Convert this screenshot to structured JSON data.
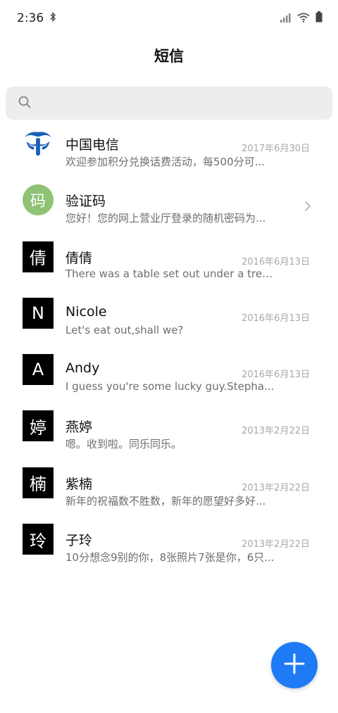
{
  "status_bar": {
    "time": "2:36"
  },
  "header": {
    "title": "短信"
  },
  "search": {
    "placeholder": ""
  },
  "conversations": [
    {
      "avatar_text": "",
      "avatar_type": "china-telecom-logo",
      "name": "中国电信",
      "date": "2017年6月30日",
      "preview": "欢迎参加积分兑换话费活动，每500分可..."
    },
    {
      "avatar_text": "码",
      "avatar_type": "circle",
      "name": "验证码",
      "date": "",
      "preview": "您好！您的网上营业厅登录的随机密码为..."
    },
    {
      "avatar_text": "倩",
      "avatar_type": "square",
      "name": "倩倩",
      "date": "2016年6月13日",
      "preview": "There was a table set out under a tree i..."
    },
    {
      "avatar_text": "N",
      "avatar_type": "square",
      "name": "Nicole",
      "date": "2016年6月13日",
      "preview": "Let's eat out,shall we?"
    },
    {
      "avatar_text": "A",
      "avatar_type": "square",
      "name": "Andy",
      "date": "2016年6月13日",
      "preview": "I guess you're some lucky guy.Stepha..."
    },
    {
      "avatar_text": "婷",
      "avatar_type": "square",
      "name": "燕婷",
      "date": "2013年2月22日",
      "preview": "嗯。收到啦。同乐同乐。"
    },
    {
      "avatar_text": "楠",
      "avatar_type": "square",
      "name": "紫楠",
      "date": "2013年2月22日",
      "preview": "新年的祝福数不胜数，新年的愿望好多好..."
    },
    {
      "avatar_text": "玲",
      "avatar_type": "square",
      "name": "子玲",
      "date": "2013年2月22日",
      "preview": "10分想念9别的你，8张照片7张是你，6只..."
    }
  ],
  "colors": {
    "fab": "#1e7bf5",
    "code_avatar": "#8fc275"
  }
}
